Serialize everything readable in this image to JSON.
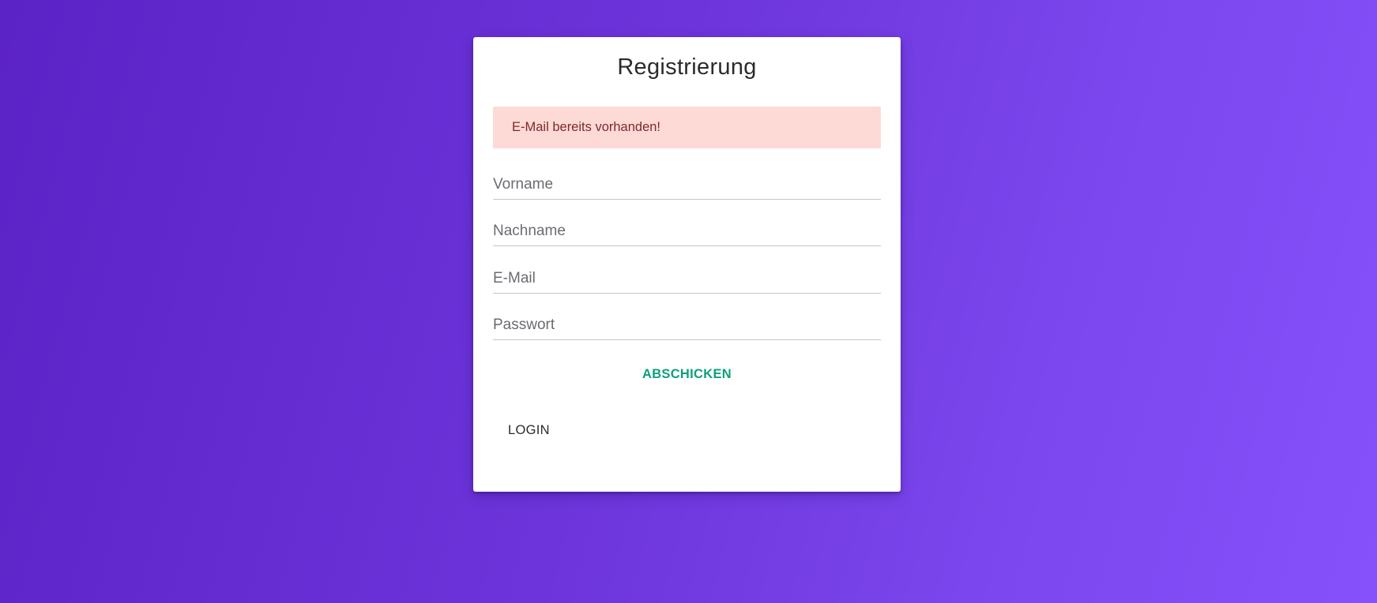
{
  "form": {
    "title": "Registrierung",
    "error_message": "E-Mail bereits vorhanden!",
    "fields": [
      {
        "placeholder": "Vorname",
        "value": ""
      },
      {
        "placeholder": "Nachname",
        "value": ""
      },
      {
        "placeholder": "E-Mail",
        "value": ""
      },
      {
        "placeholder": "Passwort",
        "value": ""
      }
    ],
    "submit_label": "ABSCHICKEN",
    "login_label": "LOGIN"
  },
  "colors": {
    "background_start": "#5b22c6",
    "background_end": "#8650fb",
    "alert_background": "#fddad6",
    "alert_text": "#7d2a2a",
    "submit_text": "#0e9f7e"
  }
}
